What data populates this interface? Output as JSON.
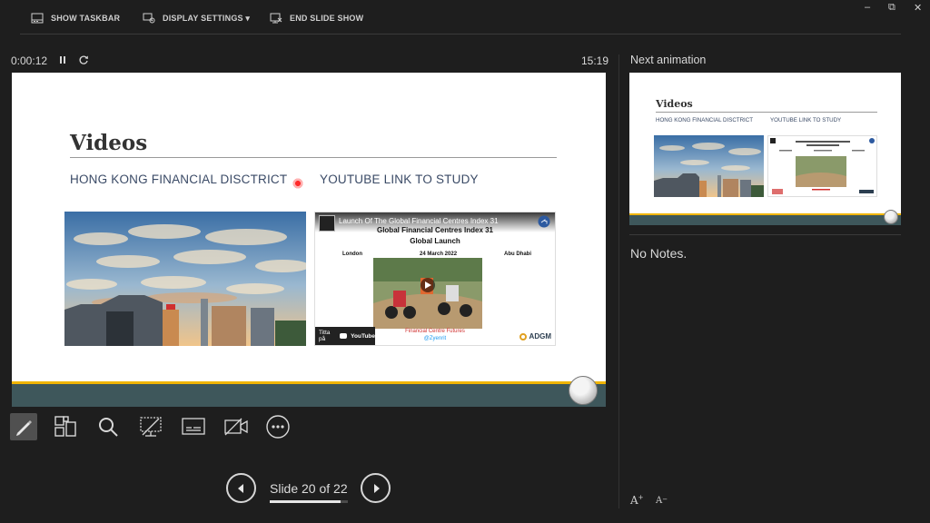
{
  "toolbar": {
    "show_taskbar": "SHOW TASKBAR",
    "display_settings": "DISPLAY SETTINGS ▾",
    "end_slide_show": "END SLIDE SHOW"
  },
  "window_controls": {
    "minimize": "–",
    "restore": "⧉",
    "close": "✕"
  },
  "presenter": {
    "elapsed": "0:00:12",
    "clock": "15:19",
    "slide_count": "Slide 20 of 22",
    "slide_index": 20,
    "slide_total": 22,
    "progress_fraction": 0.909
  },
  "slide": {
    "title": "Videos",
    "left_caption": "HONG KONG FINANCIAL DISCTRICT",
    "right_caption": "YOUTUBE LINK TO STUDY",
    "youtube": {
      "video_title": "Launch Of The Global Financial Centres Index 31",
      "heading1": "Global Financial Centres Index 31",
      "heading2": "Global Launch",
      "city_left": "London",
      "date": "24 March 2022",
      "city_right": "Abu Dhabi",
      "footer": "Financial Centre Futures",
      "handle": "@Zyenrit",
      "watch_label": "Titta på",
      "watch_brand": "YouTube",
      "brand": "ADGM"
    }
  },
  "next_panel": {
    "label": "Next animation",
    "thumb_title": "Videos",
    "thumb_left_caption": "HONG KONG FINANCIAL DISCTRICT",
    "thumb_right_caption": "YOUTUBE LINK TO STUDY"
  },
  "notes": {
    "text": "No Notes."
  },
  "font_controls": {
    "increase": "A",
    "decrease": "A"
  },
  "colors": {
    "background": "#1e1e1e",
    "slide_teal": "#3e575b",
    "slide_gold": "#f0b400",
    "caption": "#3a4a66"
  }
}
